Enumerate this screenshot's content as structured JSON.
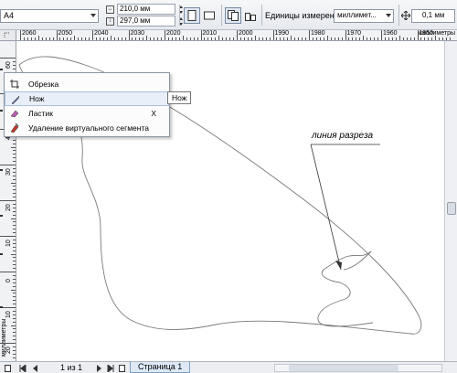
{
  "propbar": {
    "page_size": "A4",
    "width": "210,0 мм",
    "height": "297,0 мм",
    "units_label": "Единицы измерения:",
    "units_value": "миллимет...",
    "nudge": "0,1 мм"
  },
  "ruler": {
    "h_labels": [
      "2060",
      "2050",
      "2040",
      "2030",
      "2020",
      "2010",
      "2000",
      "1990",
      "1980",
      "1970",
      "1960",
      "1950"
    ],
    "h_unit": "миллиметры",
    "v_labels": [
      "60",
      "50",
      "40",
      "30",
      "20",
      "10",
      "0",
      "10",
      "20"
    ],
    "v_unit": "миллиметры"
  },
  "flyout": {
    "items": [
      {
        "label": "Обрезка",
        "shortcut": "",
        "icon": "crop-icon"
      },
      {
        "label": "Нож",
        "shortcut": "",
        "icon": "knife-icon"
      },
      {
        "label": "Ластик",
        "shortcut": "X",
        "icon": "eraser-icon"
      },
      {
        "label": "Удаление виртуального сегмента",
        "shortcut": "",
        "icon": "virtual-segment-delete-icon"
      }
    ]
  },
  "tooltip": "Нож",
  "annotation": "линия разреза",
  "bottombar": {
    "page_count": "1 из 1",
    "page_tab": "Страница 1"
  },
  "colors": {
    "highlight": "#e8eff8",
    "shape_stroke": "#777777"
  }
}
